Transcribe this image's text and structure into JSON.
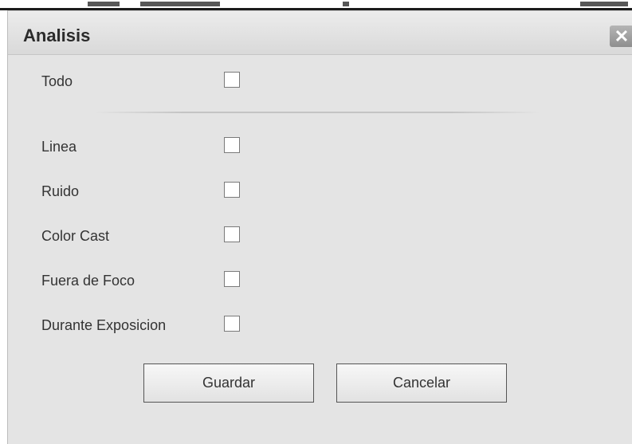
{
  "dialog": {
    "title": "Analisis",
    "close_icon": "close-icon",
    "close_glyph": "✕"
  },
  "options": [
    {
      "label": "Todo",
      "checked": false
    },
    {
      "label": "Linea",
      "checked": false
    },
    {
      "label": "Ruido",
      "checked": false
    },
    {
      "label": "Color Cast",
      "checked": false
    },
    {
      "label": "Fuera de Foco",
      "checked": false
    },
    {
      "label": "Durante Exposicion",
      "checked": false
    }
  ],
  "buttons": {
    "save_label": "Guardar",
    "cancel_label": "Cancelar"
  }
}
